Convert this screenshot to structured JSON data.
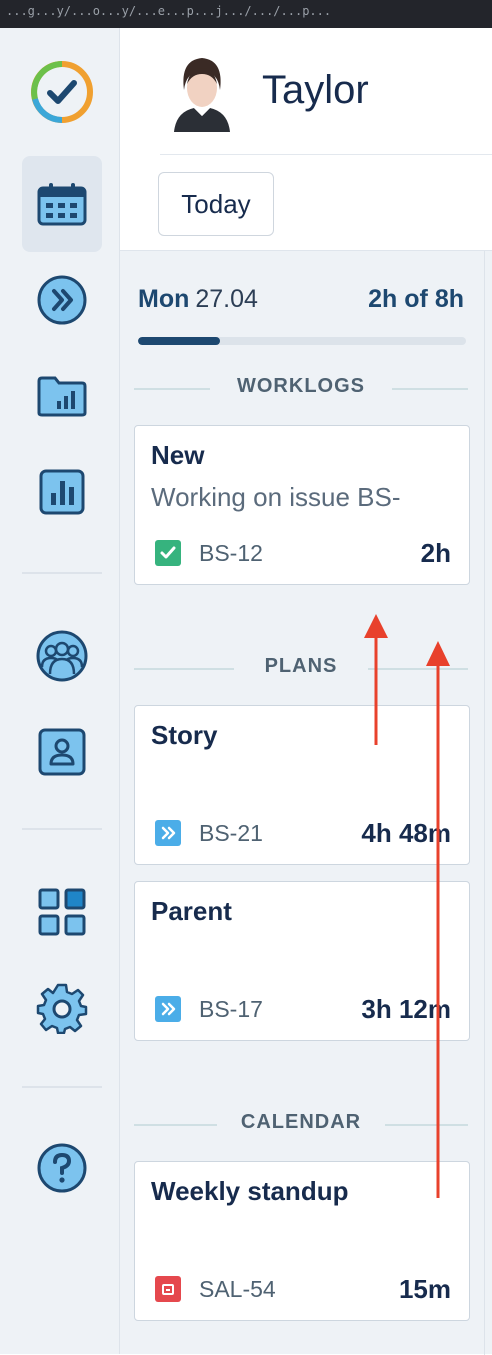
{
  "browser_bar": {
    "text": "...g...y/...o...y/...e...p...j.../.../...p..."
  },
  "sidebar": {
    "items": [
      {
        "icon": "logo-check-icon"
      },
      {
        "icon": "calendar-icon",
        "active": true
      },
      {
        "icon": "double-chevron-icon"
      },
      {
        "icon": "folder-chart-icon"
      },
      {
        "icon": "bar-chart-icon"
      },
      {
        "icon": "team-icon"
      },
      {
        "icon": "user-card-icon"
      },
      {
        "icon": "grid-icon"
      },
      {
        "icon": "gear-icon"
      },
      {
        "icon": "help-icon"
      }
    ]
  },
  "profile": {
    "name": "Taylor"
  },
  "toolbar": {
    "today_label": "Today"
  },
  "day": {
    "name": "Mon",
    "date": "27.04",
    "hours": "2h of 8h",
    "progress": 0.25
  },
  "sections": {
    "worklogs": "WORKLOGS",
    "plans": "PLANS",
    "calendar": "CALENDAR"
  },
  "worklogs": [
    {
      "title": "New",
      "desc": "Working on issue BS-",
      "key": "BS-12",
      "duration": "2h",
      "icon": "checkbox-icon",
      "color": "#36b37e"
    }
  ],
  "plans": [
    {
      "title": "Story",
      "key": "BS-21",
      "duration": "4h 48m",
      "icon": "subtask-icon",
      "color": "#4bade8"
    },
    {
      "title": "Parent",
      "key": "BS-17",
      "duration": "3h 12m",
      "icon": "subtask-icon",
      "color": "#4bade8"
    }
  ],
  "calendar": [
    {
      "title": "Weekly standup",
      "key": "SAL-54",
      "duration": "15m",
      "icon": "calendar-event-icon",
      "color": "#e5484d"
    }
  ],
  "colors": {
    "accent": "#1d4870",
    "sidebar_icon": "#1f85c8",
    "annotation_arrow": "#e8412c"
  }
}
